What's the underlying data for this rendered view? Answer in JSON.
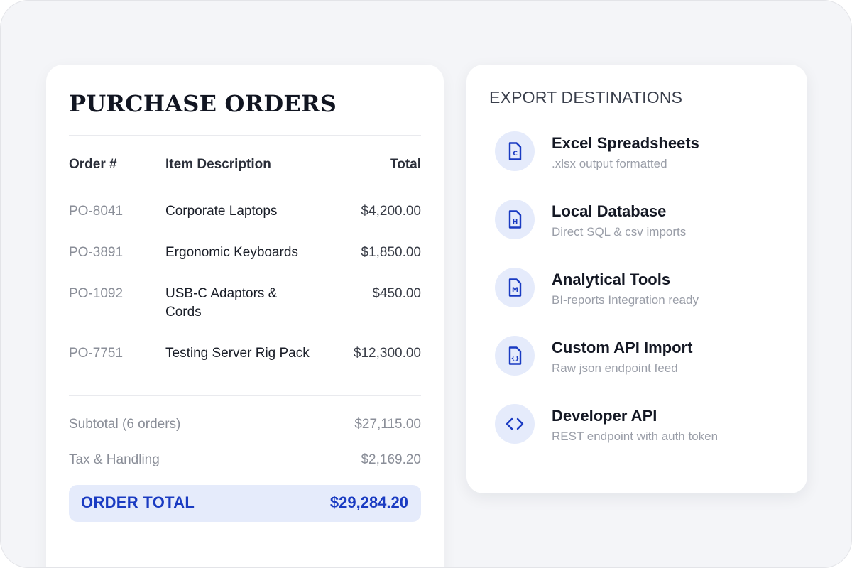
{
  "purchase_orders": {
    "title": "PURCHASE ORDERS",
    "columns": {
      "order": "Order #",
      "item": "Item Description",
      "total": "Total"
    },
    "rows": [
      {
        "order": "PO-8041",
        "item": "Corporate Laptops",
        "total": "$4,200.00"
      },
      {
        "order": "PO-3891",
        "item": "Ergonomic Keyboards",
        "total": "$1,850.00"
      },
      {
        "order": "PO-1092",
        "item": "USB-C Adaptors & Cords",
        "total": "$450.00"
      },
      {
        "order": "PO-7751",
        "item": "Testing Server Rig Pack",
        "total": "$12,300.00"
      }
    ],
    "subtotal": {
      "label": "Subtotal (6 orders)",
      "value": "$27,115.00"
    },
    "tax": {
      "label": "Tax & Handling",
      "value": "$2,169.20"
    },
    "order_total": {
      "label": "ORDER TOTAL",
      "value": "$29,284.20"
    }
  },
  "export": {
    "title": "EXPORT DESTINATIONS",
    "destinations": [
      {
        "label": "Excel Spreadsheets",
        "sub": ".xlsx output formatted",
        "icon": "file-c-icon",
        "glyph": "C"
      },
      {
        "label": "Local Database",
        "sub": "Direct SQL & csv imports",
        "icon": "file-h-icon",
        "glyph": "H"
      },
      {
        "label": "Analytical Tools",
        "sub": "BI-reports Integration ready",
        "icon": "file-m-icon",
        "glyph": "M"
      },
      {
        "label": "Custom API Import",
        "sub": "Raw json endpoint feed",
        "icon": "file-braces-icon",
        "glyph": "{}"
      },
      {
        "label": "Developer API",
        "sub": "REST endpoint with auth token",
        "icon": "code-brackets-icon"
      }
    ]
  },
  "colors": {
    "accent": "#1a3bc2",
    "accent_soft": "#e5ebfb",
    "background": "#f4f5f8"
  }
}
